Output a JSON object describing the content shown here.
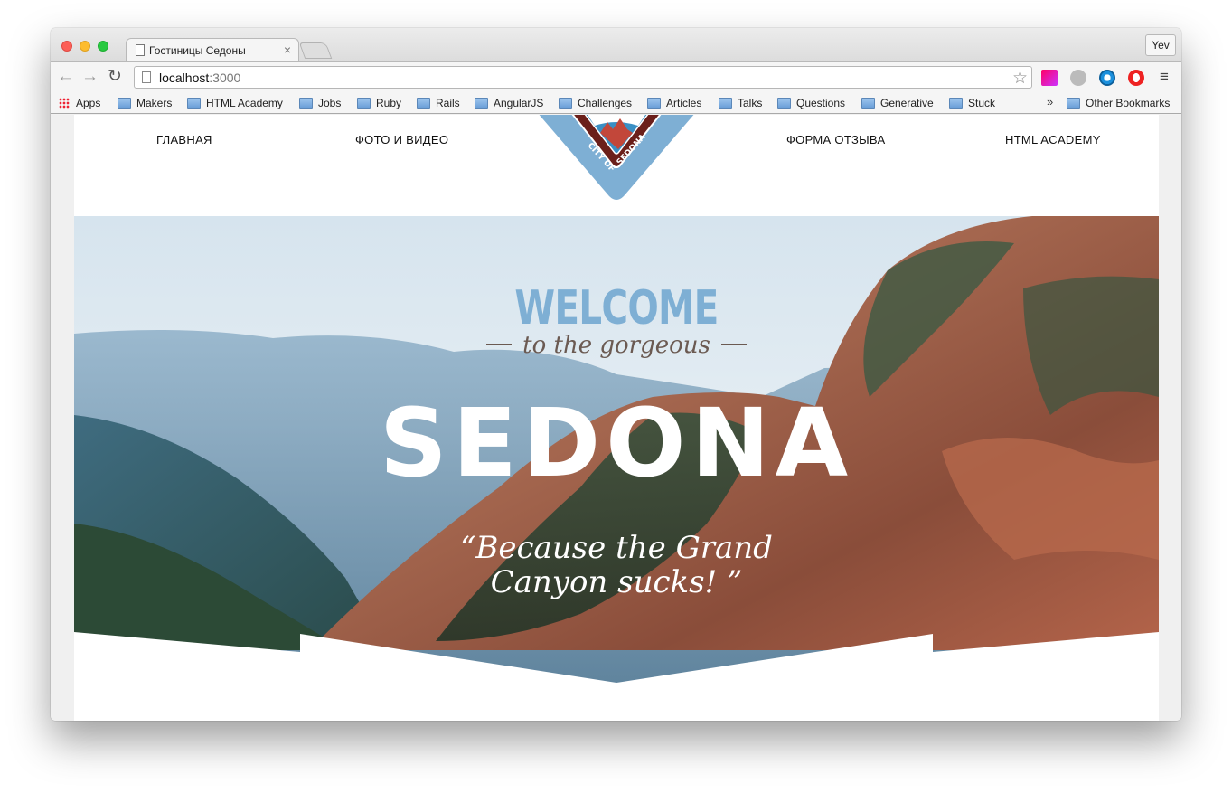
{
  "browser": {
    "tab_title": "Гостиницы Седоны",
    "tab_close": "×",
    "profile_name": "Yev",
    "url_host": "localhost",
    "url_port": ":3000",
    "nav_back": "←",
    "nav_forward": "→",
    "nav_reload": "↻",
    "star": "☆",
    "menu": "≡",
    "bookmarks": {
      "apps": "Apps",
      "folders": [
        "Makers",
        "HTML Academy",
        "Jobs",
        "Ruby",
        "Rails",
        "AngularJS",
        "Challenges",
        "Articles",
        "Talks",
        "Questions",
        "Generative",
        "Stuck"
      ],
      "more": "»",
      "other": "Other Bookmarks"
    }
  },
  "site": {
    "nav": {
      "home": "ГЛАВНАЯ",
      "photo_video": "ФОТО И ВИДЕО",
      "feedback_form": "ФОРМА ОТЗЫВА",
      "html_academy": "HTML ACADEMY"
    },
    "emblem_text": "CITY OF SEDONA",
    "hero": {
      "welcome": "WELCOME",
      "tagline": "to the gorgeous",
      "title": "SEDONA",
      "quote_line1": "“Because the Grand",
      "quote_line2": "Canyon sucks! ”"
    }
  },
  "colors": {
    "welcome": "#7eafd4",
    "tagline": "#6b5a52",
    "emblem_blue": "#7eafd4",
    "emblem_red": "#8b2a22"
  }
}
